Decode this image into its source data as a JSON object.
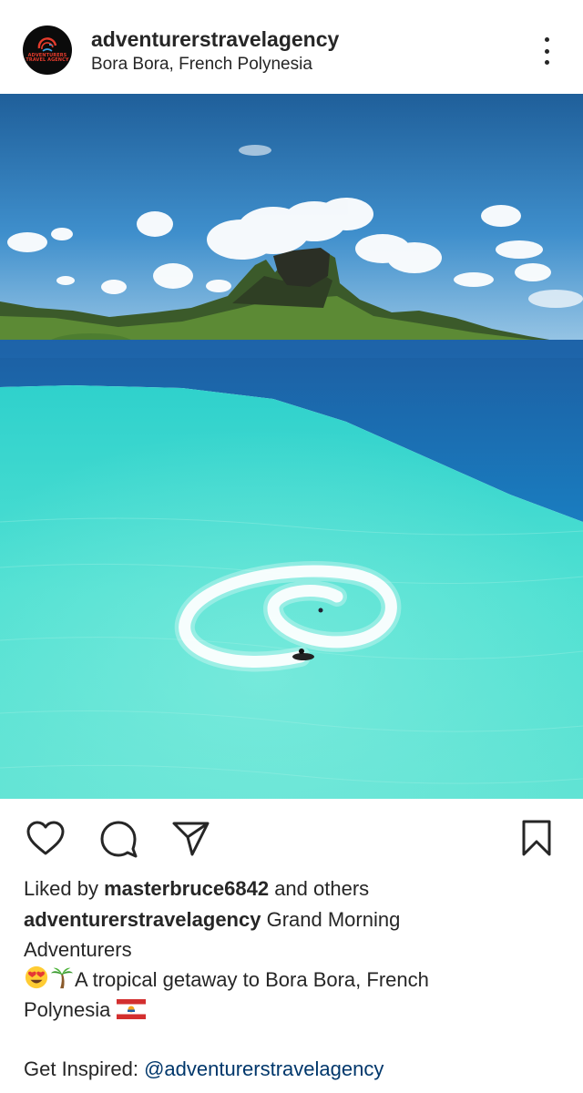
{
  "header": {
    "avatar_lines": [
      "ADVENTURERS",
      "TRAVEL AGENCY"
    ],
    "username": "adventurerstravelagency",
    "location": "Bora Bora, French Polynesia",
    "more_icon": "more-vertical-icon"
  },
  "photo": {
    "subject": "aerial-lagoon-jetski"
  },
  "actions": {
    "like_icon": "heart-icon",
    "comment_icon": "comment-icon",
    "share_icon": "paper-plane-icon",
    "save_icon": "bookmark-icon"
  },
  "likes": {
    "prefix": "Liked by ",
    "user": "masterbruce6842",
    "suffix": " and others"
  },
  "caption": {
    "username": "adventurerstravelagency",
    "line1_text": " Grand Morning",
    "line2_text": "Adventurers",
    "line3_text": "A tropical getaway to Bora Bora, French",
    "line4_text": "Polynesia ",
    "emojis": [
      "heart-eyes-emoji",
      "palm-tree-emoji",
      "french-polynesia-flag-emoji"
    ],
    "inspired_prefix": "Get Inspired: ",
    "inspired_mention": "@adventurerstravelagency"
  },
  "colors": {
    "text": "#262626",
    "mention": "#00376b",
    "lagoon": "#3fd9cf",
    "deep_water": "#1a74b8",
    "sky": "#3b8cc9"
  }
}
